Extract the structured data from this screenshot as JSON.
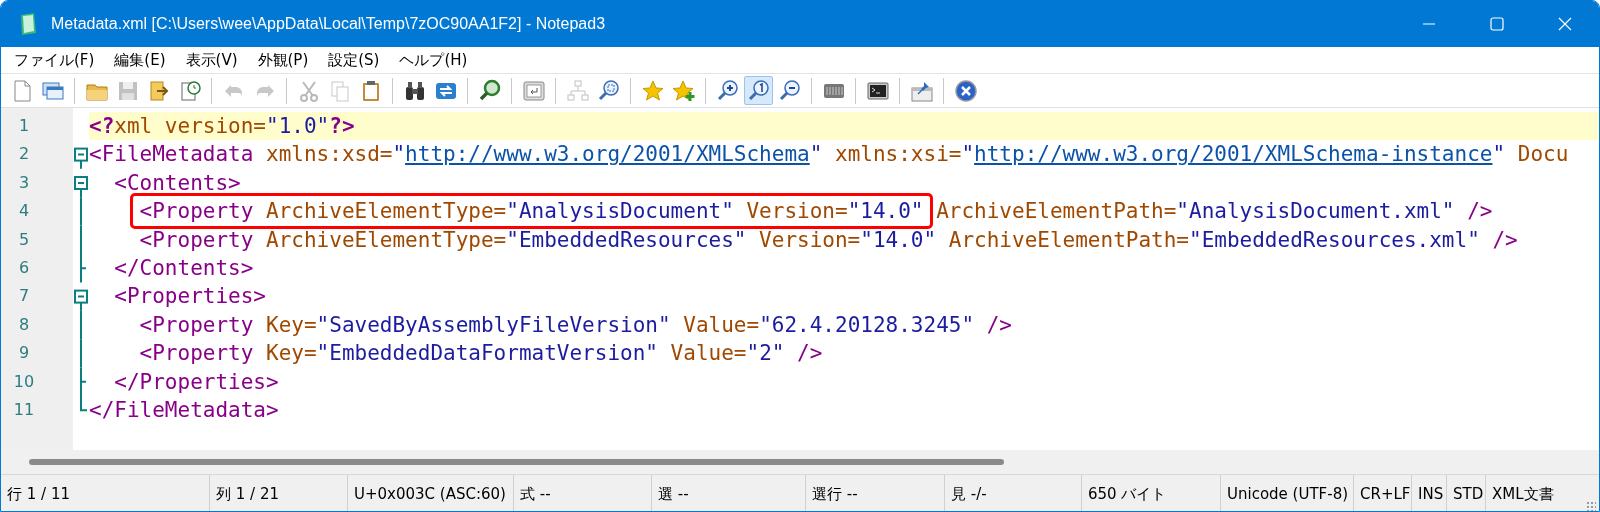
{
  "window": {
    "title": "Metadata.xml [C:\\Users\\wee\\AppData\\Local\\Temp\\7zOC90AA1F2] - Notepad3"
  },
  "menu": [
    "ファイル(F)",
    "編集(E)",
    "表示(V)",
    "外観(P)",
    "設定(S)",
    "ヘルプ(H)"
  ],
  "toolbar": [
    {
      "kind": "button",
      "disabled": false,
      "pressed": false
    },
    {
      "kind": "button",
      "disabled": false,
      "pressed": false
    },
    {
      "kind": "separator"
    },
    {
      "kind": "button",
      "disabled": false,
      "pressed": false
    },
    {
      "kind": "button",
      "disabled": true,
      "pressed": false
    },
    {
      "kind": "button",
      "disabled": false,
      "pressed": false
    },
    {
      "kind": "button",
      "disabled": false,
      "pressed": false
    },
    {
      "kind": "separator"
    },
    {
      "kind": "button",
      "disabled": true,
      "pressed": false
    },
    {
      "kind": "button",
      "disabled": true,
      "pressed": false
    },
    {
      "kind": "separator"
    },
    {
      "kind": "button",
      "disabled": true,
      "pressed": false
    },
    {
      "kind": "button",
      "disabled": true,
      "pressed": false
    },
    {
      "kind": "button",
      "disabled": false,
      "pressed": false
    },
    {
      "kind": "separator"
    },
    {
      "kind": "button",
      "disabled": false,
      "pressed": false
    },
    {
      "kind": "button",
      "disabled": false,
      "pressed": false
    },
    {
      "kind": "separator"
    },
    {
      "kind": "button",
      "disabled": false,
      "pressed": false
    },
    {
      "kind": "separator"
    },
    {
      "kind": "button",
      "disabled": false,
      "pressed": false
    },
    {
      "kind": "separator"
    },
    {
      "kind": "button",
      "disabled": true,
      "pressed": false
    },
    {
      "kind": "button",
      "disabled": false,
      "pressed": false
    },
    {
      "kind": "separator"
    },
    {
      "kind": "button",
      "disabled": false,
      "pressed": false
    },
    {
      "kind": "button",
      "disabled": false,
      "pressed": false
    },
    {
      "kind": "separator"
    },
    {
      "kind": "button",
      "disabled": false,
      "pressed": false
    },
    {
      "kind": "button",
      "disabled": false,
      "pressed": true
    },
    {
      "kind": "button",
      "disabled": false,
      "pressed": false
    },
    {
      "kind": "separator"
    },
    {
      "kind": "button",
      "disabled": false,
      "pressed": false
    },
    {
      "kind": "separator"
    },
    {
      "kind": "button",
      "disabled": false,
      "pressed": false
    },
    {
      "kind": "separator"
    },
    {
      "kind": "button",
      "disabled": false,
      "pressed": false
    },
    {
      "kind": "separator"
    },
    {
      "kind": "button",
      "disabled": false,
      "pressed": false
    }
  ],
  "editor": {
    "lines": [
      {
        "number": "1",
        "current": true,
        "kind": "plain",
        "tokens": [
          {
            "kind": "pi",
            "text": "<?"
          },
          {
            "kind": "attr",
            "text": "xml version="
          },
          {
            "kind": "value",
            "text": "\"1.0\""
          },
          {
            "kind": "pi",
            "text": "?>"
          }
        ]
      },
      {
        "number": "2",
        "current": false,
        "kind": "fold_open",
        "tokens": [
          {
            "kind": "tag",
            "text": "<FileMetadata"
          },
          {
            "kind": "attr",
            "text": " xmlns:xsd="
          },
          {
            "kind": "value",
            "text": "\""
          },
          {
            "kind": "link",
            "text": "http://www.w3.org/2001/XMLSchema"
          },
          {
            "kind": "value",
            "text": "\""
          },
          {
            "kind": "attr",
            "text": " xmlns:xsi="
          },
          {
            "kind": "value",
            "text": "\""
          },
          {
            "kind": "link",
            "text": "http://www.w3.org/2001/XMLSchema-instance"
          },
          {
            "kind": "value",
            "text": "\""
          },
          {
            "kind": "attr",
            "text": " Docu"
          }
        ]
      },
      {
        "number": "3",
        "current": false,
        "kind": "fold_open",
        "tokens": [
          {
            "kind": "tag",
            "text": "  <Contents>"
          }
        ]
      },
      {
        "number": "4",
        "current": false,
        "kind": "fold_line",
        "tokens": [
          {
            "kind": "tag",
            "text": "    <Property",
            "boxed": true
          },
          {
            "kind": "attr",
            "text": " ArchiveElementType=",
            "boxed": true
          },
          {
            "kind": "value",
            "text": "\"AnalysisDocument\"",
            "boxed": true
          },
          {
            "kind": "attr",
            "text": " Version=",
            "boxed": true
          },
          {
            "kind": "value",
            "text": "\"14.0\"",
            "boxed": true
          },
          {
            "kind": "attr",
            "text": " ArchiveElementPath="
          },
          {
            "kind": "value",
            "text": "\"AnalysisDocument.xml\""
          },
          {
            "kind": "tag",
            "text": " />"
          }
        ]
      },
      {
        "number": "5",
        "current": false,
        "kind": "fold_line",
        "tokens": [
          {
            "kind": "tag",
            "text": "    <Property"
          },
          {
            "kind": "attr",
            "text": " ArchiveElementType="
          },
          {
            "kind": "value",
            "text": "\"EmbeddedResources\""
          },
          {
            "kind": "attr",
            "text": " Version="
          },
          {
            "kind": "value",
            "text": "\"14.0\""
          },
          {
            "kind": "attr",
            "text": " ArchiveElementPath="
          },
          {
            "kind": "value",
            "text": "\"EmbeddedResources.xml\""
          },
          {
            "kind": "tag",
            "text": " />"
          }
        ]
      },
      {
        "number": "6",
        "current": false,
        "kind": "fold_end",
        "tokens": [
          {
            "kind": "tag",
            "text": "  </Contents>"
          }
        ]
      },
      {
        "number": "7",
        "current": false,
        "kind": "fold_open",
        "tokens": [
          {
            "kind": "tag",
            "text": "  <Properties>"
          }
        ]
      },
      {
        "number": "8",
        "current": false,
        "kind": "fold_line",
        "tokens": [
          {
            "kind": "tag",
            "text": "    <Property"
          },
          {
            "kind": "attr",
            "text": " Key="
          },
          {
            "kind": "value",
            "text": "\"SavedByAssemblyFileVersion\""
          },
          {
            "kind": "attr",
            "text": " Value="
          },
          {
            "kind": "value",
            "text": "\"62.4.20128.3245\""
          },
          {
            "kind": "tag",
            "text": " />"
          }
        ]
      },
      {
        "number": "9",
        "current": false,
        "kind": "fold_line",
        "tokens": [
          {
            "kind": "tag",
            "text": "    <Property"
          },
          {
            "kind": "attr",
            "text": " Key="
          },
          {
            "kind": "value",
            "text": "\"EmbeddedDataFormatVersion\""
          },
          {
            "kind": "attr",
            "text": " Value="
          },
          {
            "kind": "value",
            "text": "\"2\""
          },
          {
            "kind": "tag",
            "text": " />"
          }
        ]
      },
      {
        "number": "10",
        "current": false,
        "kind": "fold_end",
        "tokens": [
          {
            "kind": "tag",
            "text": "  </Properties>"
          }
        ]
      },
      {
        "number": "11",
        "current": false,
        "kind": "fold_last",
        "tokens": [
          {
            "kind": "tag",
            "text": "</FileMetadata>"
          }
        ]
      }
    ]
  },
  "status_bar": [
    "行 1 / 11",
    "列 1 / 21",
    "U+0x003C (ASC:60)",
    "式 --",
    "選 --",
    "選行 --",
    "見 -/-",
    "650 バイト",
    "Unicode (UTF-8)",
    "CR+LF",
    "INS",
    "STD",
    "XML文書"
  ]
}
